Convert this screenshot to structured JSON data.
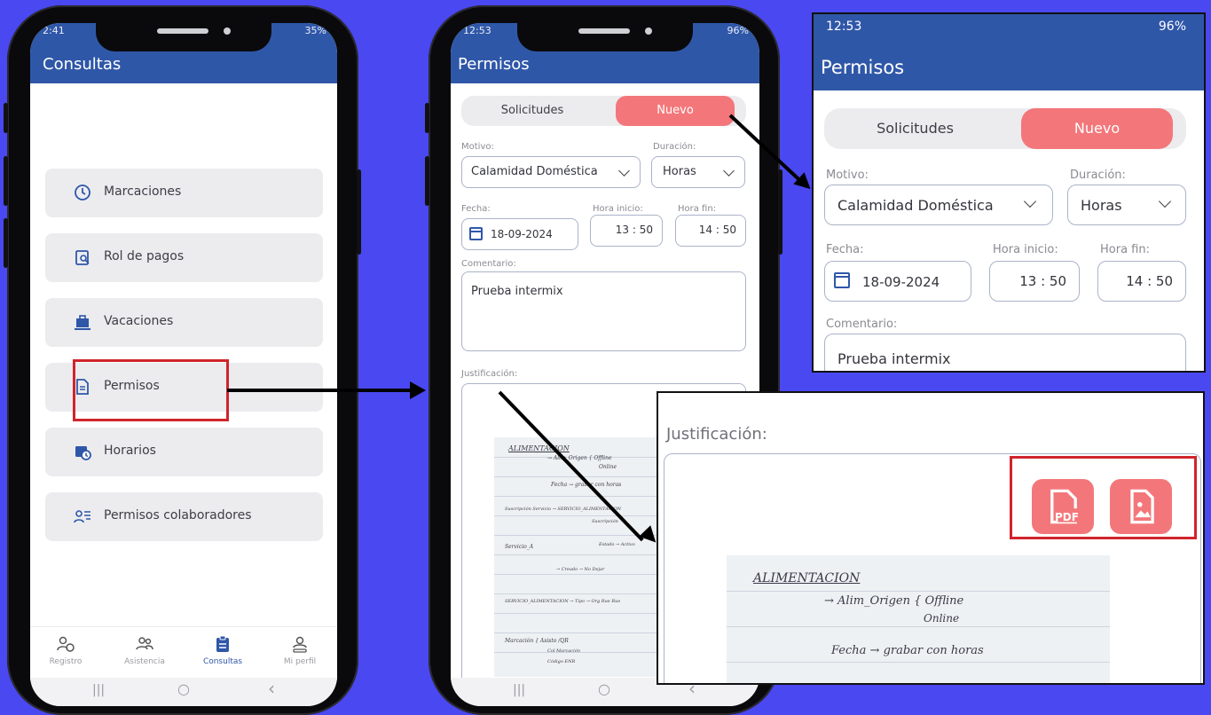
{
  "colors": {
    "background": "#4a48f0",
    "appbar": "#2f57a8",
    "accent": "#f3777a",
    "highlight": "#d0242b"
  },
  "phone1": {
    "status": {
      "time": "2:41",
      "battery": "35%"
    },
    "title": "Consultas",
    "menu": [
      {
        "label": "Marcaciones",
        "icon": "clock-check-icon"
      },
      {
        "label": "Rol de pagos",
        "icon": "clipboard-search-icon"
      },
      {
        "label": "Vacaciones",
        "icon": "briefcase-icon"
      },
      {
        "label": "Permisos",
        "icon": "document-icon"
      },
      {
        "label": "Horarios",
        "icon": "calendar-clock-icon"
      },
      {
        "label": "Permisos colaboradores",
        "icon": "users-list-icon"
      }
    ],
    "bottom_nav": [
      {
        "label": "Registro",
        "icon": "person-clock-icon"
      },
      {
        "label": "Asistencia",
        "icon": "people-icon"
      },
      {
        "label": "Consultas",
        "icon": "clipboard-icon",
        "active": true
      },
      {
        "label": "Mi perfil",
        "icon": "profile-icon"
      }
    ],
    "system_nav": {
      "recents": "|||",
      "home": "○",
      "back": "‹"
    }
  },
  "phone2": {
    "status": {
      "time": "12:53",
      "battery": "96%"
    },
    "title": "Permisos",
    "tabs": {
      "requests": "Solicitudes",
      "new": "Nuevo"
    },
    "form": {
      "reason_label": "Motivo:",
      "reason_value": "Calamidad Doméstica",
      "duration_label": "Duración:",
      "duration_value": "Horas",
      "date_label": "Fecha:",
      "date_value": "18-09-2024",
      "start_label": "Hora inicio:",
      "start_value": "13 : 50",
      "end_label": "Hora fin:",
      "end_value": "14 : 50",
      "comment_label": "Comentario:",
      "comment_value": "Prueba intermix",
      "justification_label": "Justificación:"
    },
    "notes": {
      "heading": "ALIMENTACION",
      "line1": "→ Alim_Origen { Offline",
      "line1b": "Online",
      "line2": "Fecha → grabar con horas",
      "line3": "Suscripción Servicio → SERVICIO_ALIMENTACION",
      "line4": "Suscripción",
      "line5": "Servicio_A",
      "line6": "Estado → Activo",
      "line7": "→ Creado → No Dejar",
      "line8": "SERVICIO_ALIMENTACION → Tipo → Org Rue Rue",
      "line9": "Marcación { Asisto /QR",
      "line10": "Col Marcación",
      "line11": "Código ENR"
    },
    "system_nav": {
      "recents": "|||",
      "home": "○",
      "back": "‹"
    }
  },
  "zoom_top": {
    "status": {
      "time": "12:53",
      "battery": "96%"
    },
    "title": "Permisos",
    "tabs": {
      "requests": "Solicitudes",
      "new": "Nuevo"
    },
    "form": {
      "reason_label": "Motivo:",
      "reason_value": "Calamidad Doméstica",
      "duration_label": "Duración:",
      "duration_value": "Horas",
      "date_label": "Fecha:",
      "date_value": "18-09-2024",
      "start_label": "Hora inicio:",
      "start_value": "13 : 50",
      "end_label": "Hora fin:",
      "end_value": "14 : 50",
      "comment_label": "Comentario:",
      "comment_value": "Prueba intermix"
    }
  },
  "zoom_bottom": {
    "justification_label": "Justificación:",
    "pdf_label": "PDF",
    "notes": {
      "heading": "ALIMENTACION",
      "line1": "→ Alim_Origen { Offline",
      "line1b": "Online",
      "line2": "Fecha → grabar con horas"
    }
  }
}
